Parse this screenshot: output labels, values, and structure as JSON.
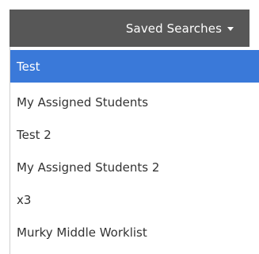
{
  "dropdown": {
    "label": "Saved Searches",
    "caret_icon": "caret-down-icon"
  },
  "menu": {
    "items": [
      {
        "label": "Test",
        "selected": true
      },
      {
        "label": "My Assigned Students",
        "selected": false
      },
      {
        "label": "Test 2",
        "selected": false
      },
      {
        "label": "My Assigned Students 2",
        "selected": false
      },
      {
        "label": "x3",
        "selected": false
      },
      {
        "label": "Murky Middle Worklist",
        "selected": false
      }
    ]
  },
  "colors": {
    "button_bg": "#575757",
    "selected_bg": "#3a79d9",
    "text": "#333333"
  }
}
